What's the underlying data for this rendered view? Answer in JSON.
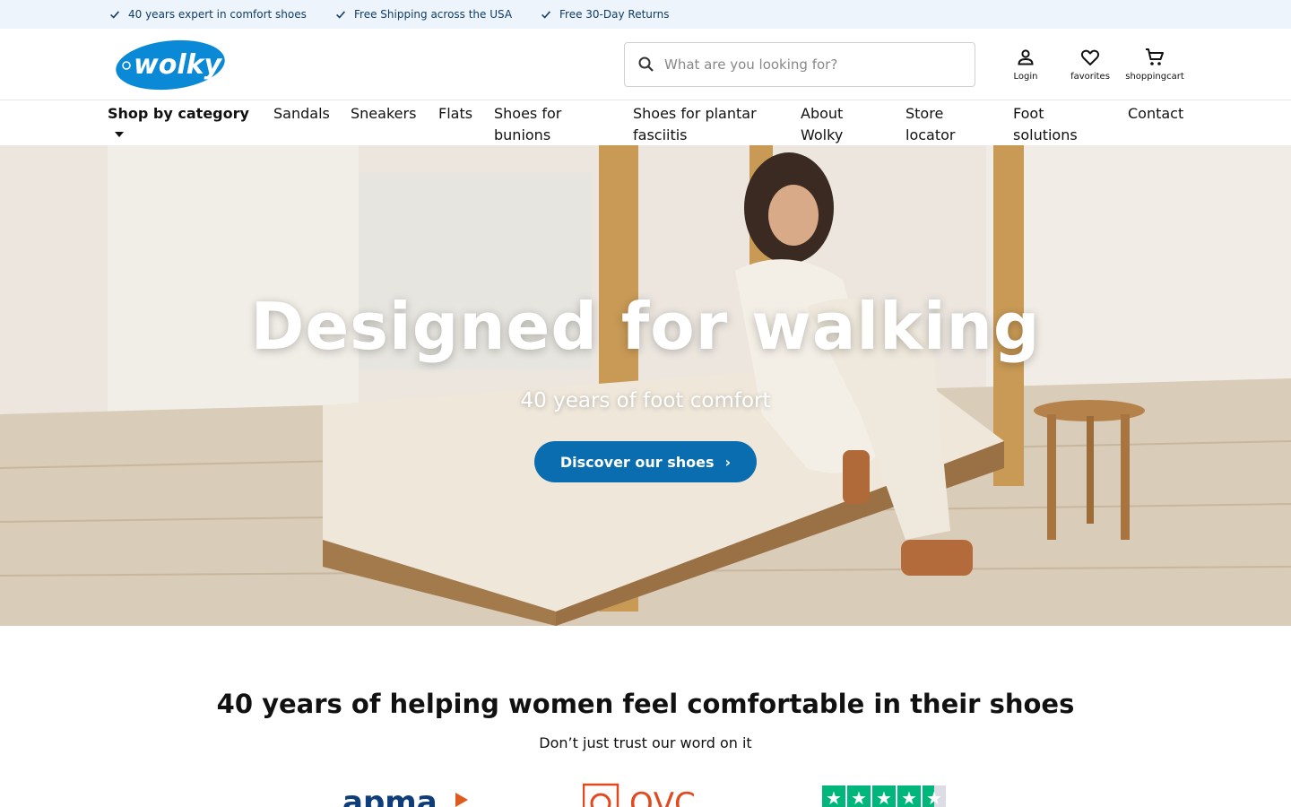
{
  "usp": [
    {
      "text": "40 years expert in comfort shoes",
      "icon": "check-icon"
    },
    {
      "text": "Free Shipping across the USA",
      "icon": "check-icon"
    },
    {
      "text": "Free 30-Day Returns",
      "icon": "check-icon"
    }
  ],
  "header": {
    "logo_text": "wolky",
    "search_placeholder": "What are you looking for?",
    "icons": [
      {
        "label": "Login",
        "icon": "user-icon"
      },
      {
        "label": "favorites",
        "icon": "heart-icon"
      },
      {
        "label": "shoppingcart",
        "icon": "cart-icon"
      }
    ]
  },
  "nav": {
    "items": [
      {
        "line1": "Shop by category",
        "line2": ""
      },
      {
        "line1": "Sandals",
        "line2": ""
      },
      {
        "line1": "Sneakers",
        "line2": ""
      },
      {
        "line1": "Flats",
        "line2": ""
      },
      {
        "line1": "Shoes for",
        "line2": "bunions"
      },
      {
        "line1": "Shoes for plantar",
        "line2": "fasciitis"
      },
      {
        "line1": "About",
        "line2": "Wolky"
      },
      {
        "line1": "Store",
        "line2": "locator"
      },
      {
        "line1": "Foot",
        "line2": "solutions"
      },
      {
        "line1": "Contact",
        "line2": ""
      }
    ]
  },
  "hero": {
    "title": "Designed for walking",
    "subtitle": "40 years of foot comfort",
    "cta_label": "Discover our shoes",
    "cta_color": "#0a6db0"
  },
  "trust": {
    "title": "40 years of helping women feel comfortable in their shoes",
    "subtitle": "Don’t just trust our word on it",
    "badges": [
      {
        "text": "apma",
        "brand_color": "#0f3d7a"
      },
      {
        "text": "QVC",
        "brand_color": "#e04a1f"
      },
      {
        "text": "Trustpilot stars",
        "brand_color": "#00b67a"
      }
    ]
  },
  "colors": {
    "usp_bg": "#eef4fb",
    "usp_text": "#0f3d66",
    "brand_blue": "#0a8ad6"
  }
}
